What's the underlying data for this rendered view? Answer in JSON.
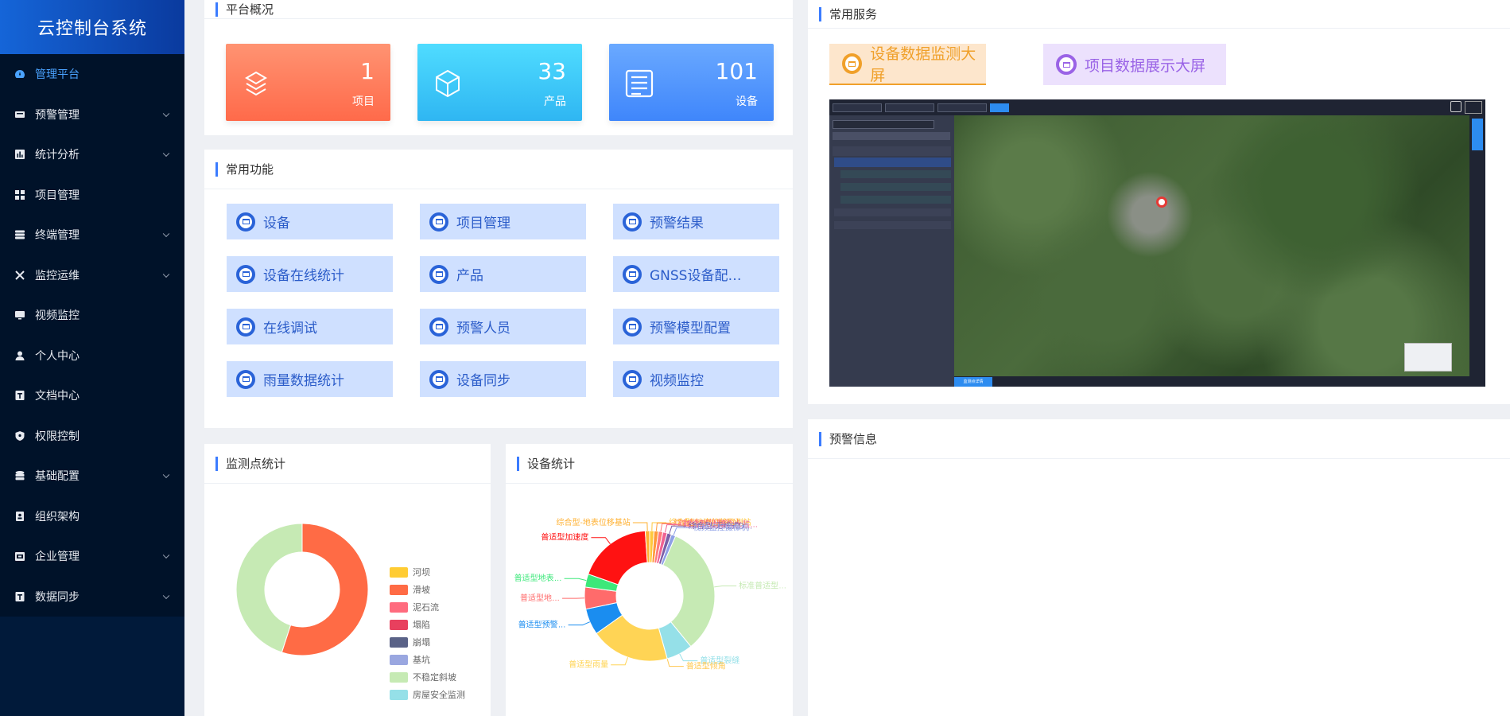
{
  "app": {
    "title": "云控制台系统"
  },
  "sidebar": {
    "items": [
      {
        "label": "管理平台",
        "icon": "dashboard-icon",
        "active": true,
        "expandable": false
      },
      {
        "label": "预警管理",
        "icon": "alarm-icon",
        "active": false,
        "expandable": true
      },
      {
        "label": "统计分析",
        "icon": "chart-icon",
        "active": false,
        "expandable": true
      },
      {
        "label": "项目管理",
        "icon": "grid-icon",
        "active": false,
        "expandable": false
      },
      {
        "label": "终端管理",
        "icon": "server-icon",
        "active": false,
        "expandable": true
      },
      {
        "label": "监控运维",
        "icon": "tools-icon",
        "active": false,
        "expandable": true
      },
      {
        "label": "视频监控",
        "icon": "monitor-icon",
        "active": false,
        "expandable": false
      },
      {
        "label": "个人中心",
        "icon": "user-icon",
        "active": false,
        "expandable": false
      },
      {
        "label": "文档中心",
        "icon": "document-icon",
        "active": false,
        "expandable": false
      },
      {
        "label": "权限控制",
        "icon": "shield-icon",
        "active": false,
        "expandable": false
      },
      {
        "label": "基础配置",
        "icon": "database-icon",
        "active": false,
        "expandable": true
      },
      {
        "label": "组织架构",
        "icon": "contacts-icon",
        "active": false,
        "expandable": false
      },
      {
        "label": "企业管理",
        "icon": "building-icon",
        "active": false,
        "expandable": true
      },
      {
        "label": "数据同步",
        "icon": "sync-icon",
        "active": false,
        "expandable": true
      }
    ]
  },
  "overview": {
    "title": "平台概况",
    "cards": [
      {
        "value": "1",
        "label": "项目",
        "icon": "layers-icon",
        "color_from": "#ff9372",
        "color_to": "#ff6a4a"
      },
      {
        "value": "33",
        "label": "产品",
        "icon": "cube-icon",
        "color_from": "#4fdcff",
        "color_to": "#2fb6f2"
      },
      {
        "value": "101",
        "label": "设备",
        "icon": "list-icon",
        "color_from": "#6aa9ff",
        "color_to": "#3f86fb"
      }
    ]
  },
  "functions": {
    "title": "常用功能",
    "items": [
      "设备",
      "项目管理",
      "预警结果",
      "设备在线统计",
      "产品",
      "GNSS设备配…",
      "在线调试",
      "预警人员",
      "预警模型配置",
      "雨量数据统计",
      "设备同步",
      "视频监控"
    ]
  },
  "services": {
    "title": "常用服务",
    "items": [
      {
        "label": "设备数据监测大屏",
        "color": "#f0a02a",
        "bg": "#fde6cc"
      },
      {
        "label": "项目数据展示大屏",
        "color": "#9a63e6",
        "bg": "#ece1fd"
      }
    ],
    "preview_tab": "监测点详情"
  },
  "warning": {
    "title": "预警信息"
  },
  "monitor_stats": {
    "title": "监测点统计",
    "chart_data": {
      "type": "pie",
      "categories": [
        "河坝",
        "滑坡",
        "泥石流",
        "塌陷",
        "崩塌",
        "基坑",
        "不稳定斜坡",
        "房屋安全监测"
      ],
      "values": [
        0,
        55,
        0,
        0,
        0,
        0,
        45,
        0
      ],
      "colors": [
        "#ffcc33",
        "#ff6b45",
        "#ff6b7e",
        "#e8405e",
        "#5a6287",
        "#9aa7e0",
        "#c6eab4",
        "#95e0e8"
      ]
    }
  },
  "device_stats": {
    "title": "设备统计",
    "chart_data": {
      "type": "pie",
      "categories": [
        "综合型-地表位移监测站",
        "综合型-水位监测站",
        "综合型-裂缝仪",
        "综合型-土壤含水监…",
        "综合型-无线式D…",
        "视频监控摄像机",
        "标准普适型…",
        "普适型裂缝",
        "普适型倾角",
        "普适型雨量",
        "普适型预警…",
        "普适型地…",
        "普适型地表…",
        "普适型加速度",
        "综合型-地表位移基站"
      ],
      "values": [
        1,
        1,
        1,
        1,
        1,
        1,
        30,
        6,
        0,
        18,
        6,
        5,
        3,
        17,
        1
      ],
      "colors": [
        "#ffc83d",
        "#ff9a3b",
        "#ff7a7a",
        "#f06292",
        "#7b5ea7",
        "#8ea0e6",
        "#c6eab4",
        "#95e0e8",
        "#ffc850",
        "#ffd455",
        "#1a8df0",
        "#ff6b6b",
        "#3ce87a",
        "#ff1212",
        "#ffb030"
      ]
    }
  }
}
